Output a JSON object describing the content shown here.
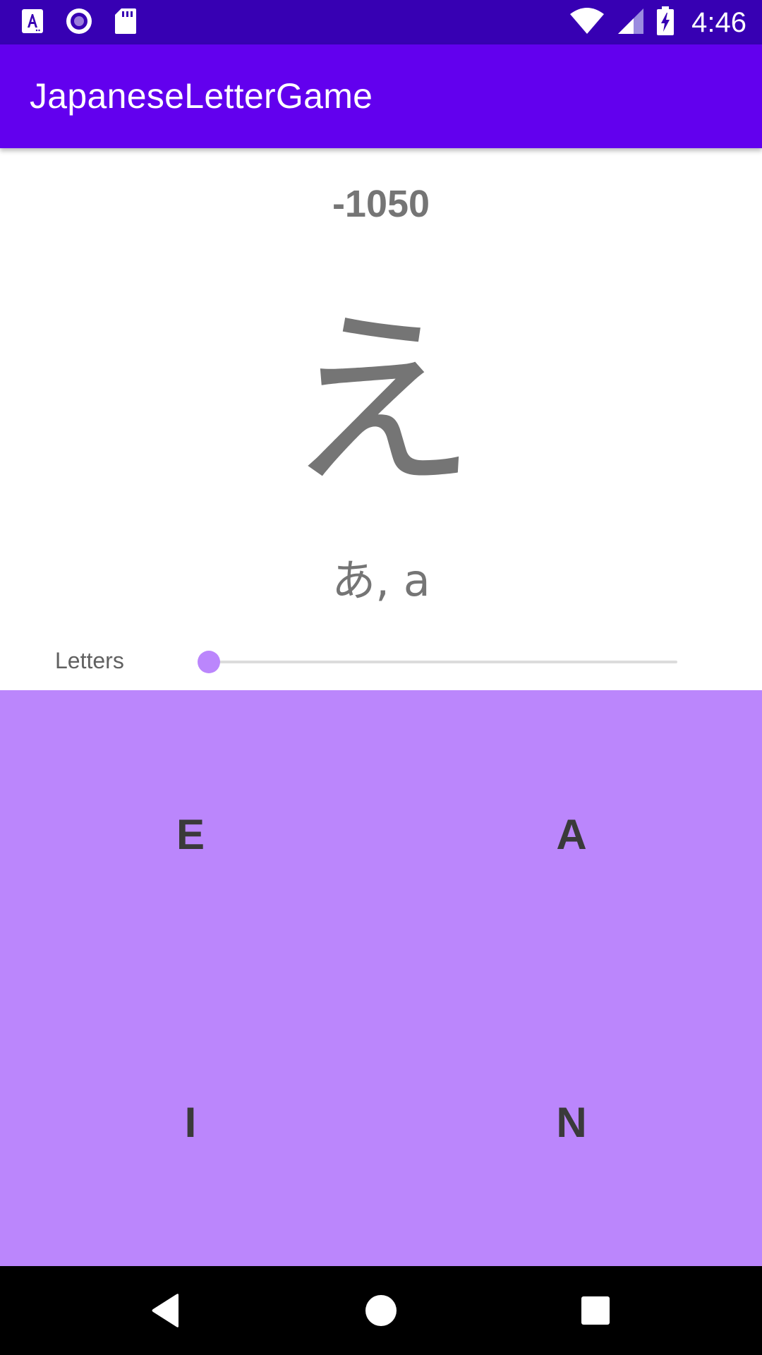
{
  "status_bar": {
    "time": "4:46",
    "left_icons": [
      "font-a-icon",
      "record-circle-icon",
      "sd-card-icon"
    ],
    "right_icons": [
      "wifi-icon",
      "cell-signal-icon",
      "battery-charging-icon"
    ]
  },
  "app_bar": {
    "title": "JapaneseLetterGame"
  },
  "game": {
    "score": "-1050",
    "kana": "え",
    "hint": "あ, a"
  },
  "slider": {
    "label": "Letters",
    "value_fraction": 0.0
  },
  "answers": [
    {
      "label": "E"
    },
    {
      "label": "A"
    },
    {
      "label": "I"
    },
    {
      "label": "N"
    }
  ],
  "colors": {
    "status_bar": "#3700b3",
    "app_bar": "#6200ee",
    "accent": "#bb86fc",
    "text_gray": "#757575"
  },
  "nav_bar": {
    "icons": [
      "back-icon",
      "home-icon",
      "recents-icon"
    ]
  }
}
